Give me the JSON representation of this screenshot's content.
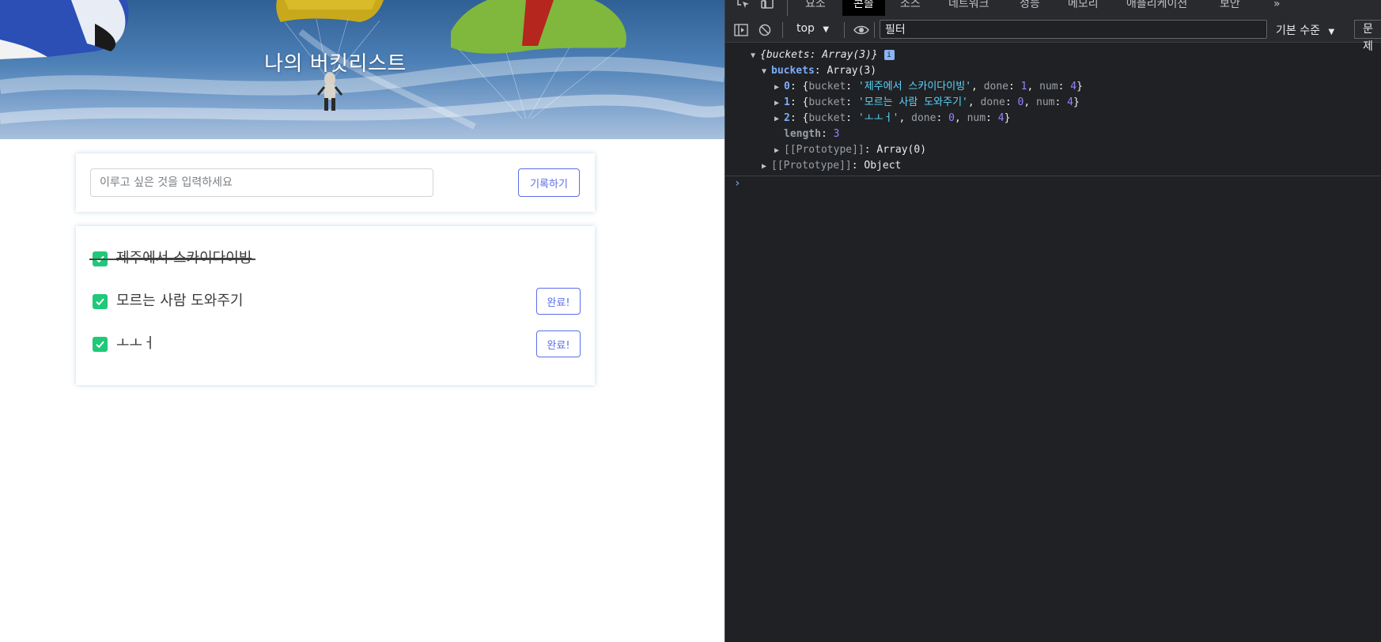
{
  "page": {
    "hero_title": "나의 버킷리스트",
    "input_placeholder": "이루고 싶은 것을 입력하세요",
    "record_button": "기록하기",
    "items": [
      {
        "text": "제주에서 스카이다이빙",
        "done": true
      },
      {
        "text": "모르는 사람 도와주기",
        "done": false,
        "button": "완료!"
      },
      {
        "text": "ㅗㅗㅓ",
        "done": false,
        "button": "완료!"
      }
    ]
  },
  "devtools": {
    "tabs": [
      "요소",
      "콘솔",
      "소스",
      "네트워크",
      "성능",
      "메모리",
      "애플리케이션",
      "보안"
    ],
    "active_tab": "콘솔",
    "more": "»",
    "context": "top",
    "filter_placeholder": "필터",
    "level": "기본 수준",
    "issues": "문제",
    "console": {
      "root": "{buckets: Array(3)}",
      "buckets_label": "buckets",
      "buckets_type": "Array(3)",
      "entries": [
        {
          "index": "0",
          "bucket": "'제주에서 스카이다이빙'",
          "done": "1",
          "num": "4"
        },
        {
          "index": "1",
          "bucket": "'모르는 사람 도와주기'",
          "done": "0",
          "num": "4"
        },
        {
          "index": "2",
          "bucket": "'ㅗㅗㅓ'",
          "done": "0",
          "num": "4"
        }
      ],
      "length_label": "length",
      "length_value": "3",
      "proto_array": "[[Prototype]]",
      "proto_array_value": "Array(0)",
      "proto_object": "[[Prototype]]",
      "proto_object_value": "Object"
    }
  },
  "colors": {
    "accent": "#5b6ee8",
    "checkbox": "#1ec979",
    "devtools_bg": "#202124"
  }
}
